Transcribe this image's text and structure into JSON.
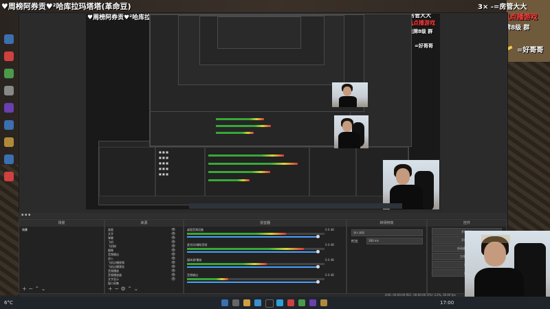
{
  "overlay": {
    "title_line": "♥周榜阿券贡♥²哈库拉玛塔塔(革命豆)",
    "title_inner": "♥周榜阿券贡♥²哈库拉玛塔塔(革命豆)",
    "gift": "3× -=房管大大",
    "gift_inner": "3× -=房管大大",
    "feiji": "飞机点播游戏",
    "feiji_inner": "飞机点播游戏",
    "fans": "粉丝牌8级 群",
    "fans_inner": "粉丝牌8级 群",
    "haoge": "=好哥哥",
    "haoge_inner": "=好哥哥"
  },
  "obs": {
    "docks": {
      "scenes": "场景",
      "sources": "来源",
      "mixer": "混音器",
      "transitions": "转场特效",
      "controls": "控件"
    },
    "scene_items": [
      "场景"
    ],
    "source_items": [
      "画面",
      "文字",
      "弹幕",
      "飞机",
      "飞机粉",
      "摄像",
      "音频输出",
      "进入",
      "飞机点播视频",
      "飞机点播预览",
      "音频播放",
      "音频播放器",
      "文字显示",
      "窗口采集",
      "窗口采集器"
    ],
    "mixer_channels": [
      {
        "label": "桌面音频设备",
        "db": "0.0 dB",
        "level": 0.72
      },
      {
        "label": "麦克风/辅助音频",
        "db": "0.0 dB",
        "level": 0.85
      },
      {
        "label": "媒体源/播放",
        "db": "0.0 dB",
        "level": 0.58
      },
      {
        "label": "音频输出",
        "db": "0.0 dB",
        "level": 0.3
      }
    ],
    "transition_label": "淡入淡出",
    "duration_label": "时长",
    "duration_value": "300 ms",
    "control_buttons": [
      "开始推流",
      "开始录制",
      "启动虚拟摄像机",
      "工作室模式",
      "设置",
      "退出"
    ],
    "status_bar": "LIVE: 00:00:00   REC: 00:00:00   CPU: 3.2%, 30.00 fps"
  },
  "taskbar": {
    "weather": "6°C",
    "time": "17:00"
  },
  "colors": {
    "overlay_text": "#ffffff",
    "overlay_red": "#ff3a3a",
    "obs_bg": "#2b2b2b",
    "meter_green": "#38a838",
    "slider_blue": "#4aa0ff"
  }
}
